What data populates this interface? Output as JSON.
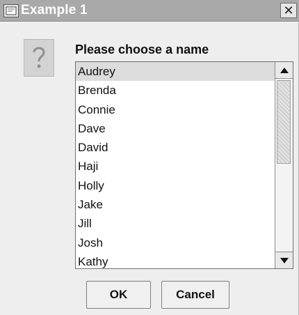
{
  "window": {
    "title": "Example 1",
    "close_symbol": "✕"
  },
  "dialog": {
    "prompt": "Please choose a name",
    "icon": "question-icon",
    "names": [
      "Audrey",
      "Brenda",
      "Connie",
      "Dave",
      "David",
      "Haji",
      "Holly",
      "Jake",
      "Jill",
      "Josh",
      "Kathy"
    ],
    "selected": "Audrey"
  },
  "buttons": {
    "ok": "OK",
    "cancel": "Cancel"
  }
}
